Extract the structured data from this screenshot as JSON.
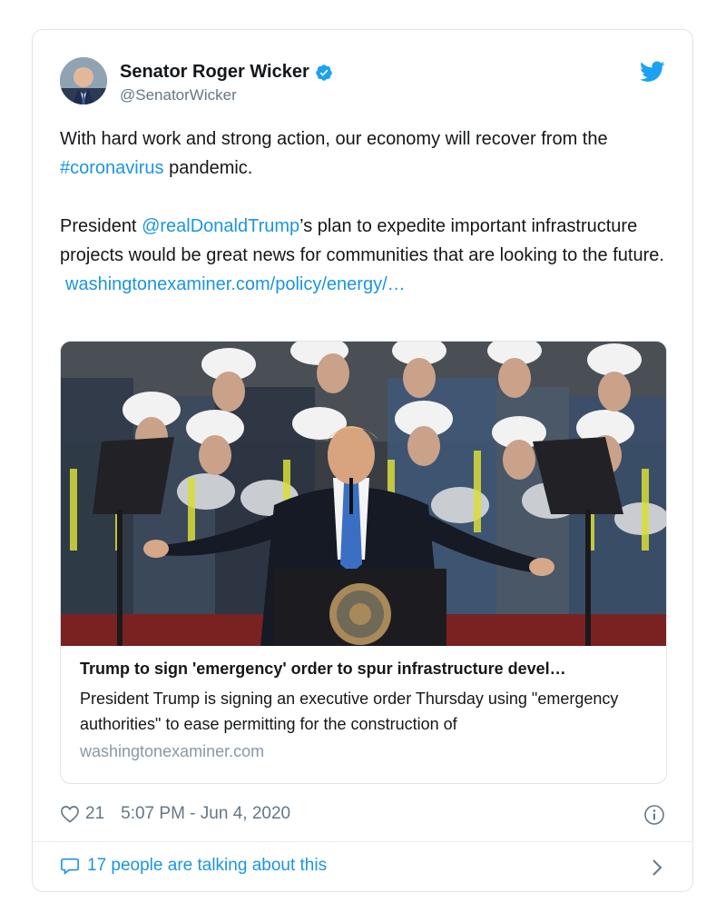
{
  "author": {
    "display_name": "Senator Roger Wicker",
    "handle": "@SenatorWicker",
    "verified": true,
    "avatar_icon": "profile-photo"
  },
  "tweet": {
    "para1_pre": "With hard work and strong action, our economy will recover from the ",
    "para1_hashtag": "#coronavirus",
    "para1_post": " pandemic.",
    "para2_pre": "President ",
    "para2_mention": "@realDonaldTrump",
    "para2_post": "’s plan to expedite important infrastructure projects would be great news for communities that are looking to the future.",
    "url": "washingtonexaminer.com/policy/energy/…"
  },
  "link_card": {
    "image_alt": "photo of speaker at podium in front of workers in hard hats",
    "title": "Trump to sign 'emergency' order to spur infrastructure devel…",
    "description": "President Trump is signing an executive order Thursday using \"emergency authorities\" to ease permitting for the construction of",
    "domain": "washingtonexaminer.com"
  },
  "meta": {
    "like_count": "21",
    "timestamp": "5:07 PM - Jun 4, 2020"
  },
  "footer": {
    "talking_label": "17 people are talking about this"
  },
  "colors": {
    "link": "#1b95e0",
    "verified": "#1da1f2",
    "secondary_text": "#657786"
  }
}
